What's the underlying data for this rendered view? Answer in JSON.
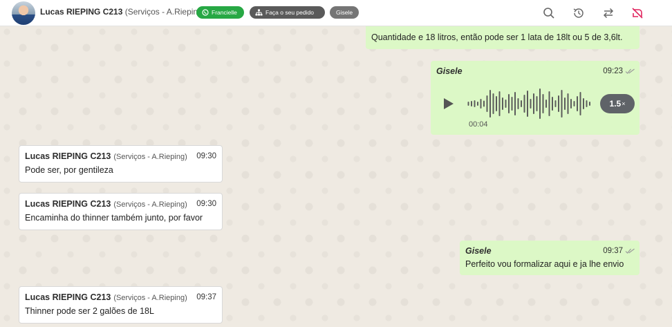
{
  "header": {
    "contact_name": "Lucas RIEPING C213",
    "contact_sub": "(Serviços - A.Rieping)",
    "tags": {
      "whatsapp": "Francielle",
      "order": "Faça o seu pedido",
      "agent": "Gisele"
    },
    "icons": [
      "search-icon",
      "history-icon",
      "transfer-icon",
      "unread-icon"
    ]
  },
  "messages": {
    "qty": {
      "text": "Quantidade e 18 litros, então pode ser 1 lata de 18lt ou 5 de 3,6lt."
    },
    "audio": {
      "author": "Gisele",
      "time": "09:23",
      "duration": "00:04",
      "speed": "1.5",
      "speed_unit": "×"
    },
    "in1": {
      "sender": "Lucas RIEPING C213",
      "sender_sub": "(Serviços - A.Rieping)",
      "time": "09:30",
      "text": "Pode ser, por gentileza"
    },
    "in2": {
      "sender": "Lucas RIEPING C213",
      "sender_sub": "(Serviços - A.Rieping)",
      "time": "09:30",
      "text": "Encaminha do thinner também junto, por favor"
    },
    "out2": {
      "author": "Gisele",
      "time": "09:37",
      "text": "Perfeito vou formalizar aqui e ja lhe envio"
    },
    "in3": {
      "sender": "Lucas RIEPING C213",
      "sender_sub": "(Serviços - A.Rieping)",
      "time": "09:37",
      "text": "Thinner pode ser 2 galões de 18L"
    }
  },
  "colors": {
    "out_bubble": "#dcf8c6",
    "in_bubble": "#ffffff",
    "whatsapp_tag": "#27a844",
    "dark_tag": "#5a5a5a",
    "unread_icon": "#e0245e"
  }
}
